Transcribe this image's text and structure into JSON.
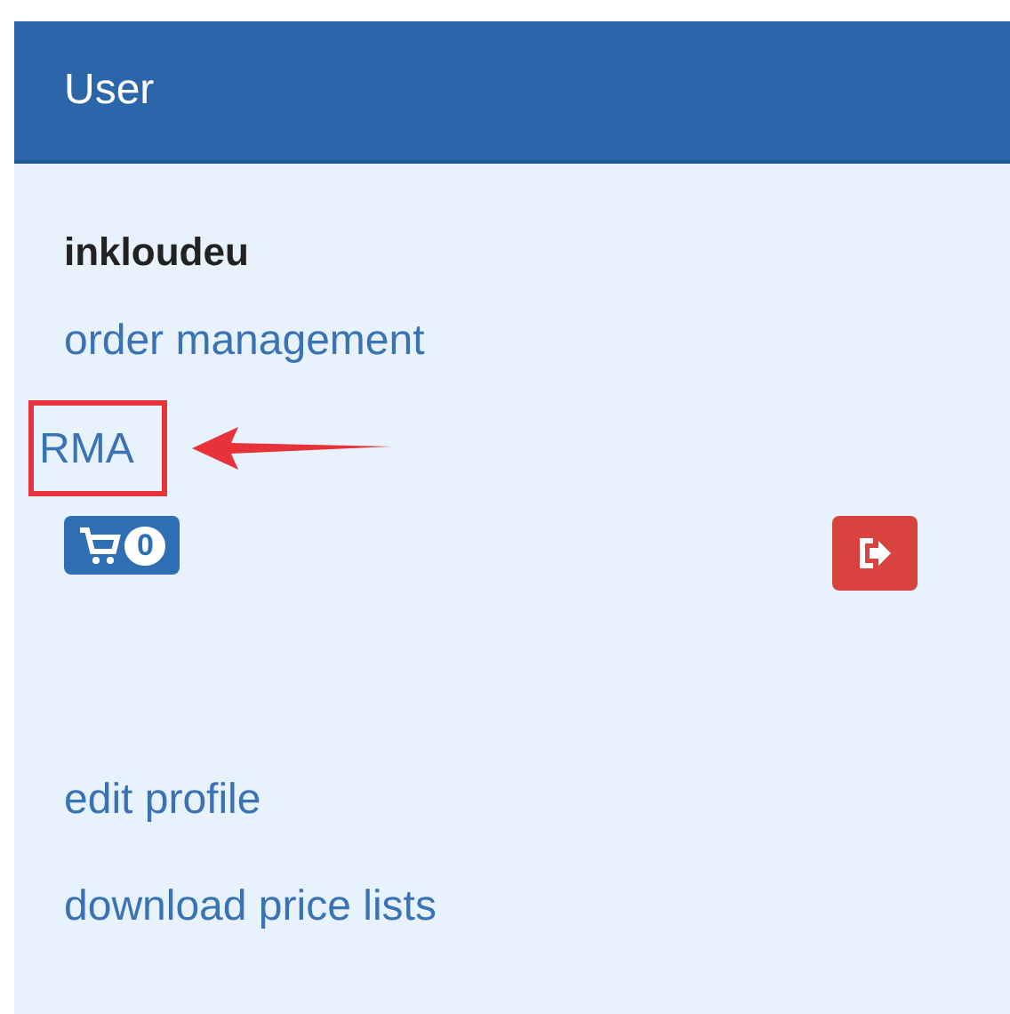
{
  "panel": {
    "title": "User"
  },
  "username": "inkloudeu",
  "links_top": [
    {
      "label": "order management",
      "annotated": false
    },
    {
      "label": "RMA",
      "annotated": true
    }
  ],
  "cart": {
    "count": "0"
  },
  "links_bottom": [
    {
      "label": "edit profile",
      "annotated": false
    },
    {
      "label": "download price lists",
      "annotated": false
    }
  ]
}
